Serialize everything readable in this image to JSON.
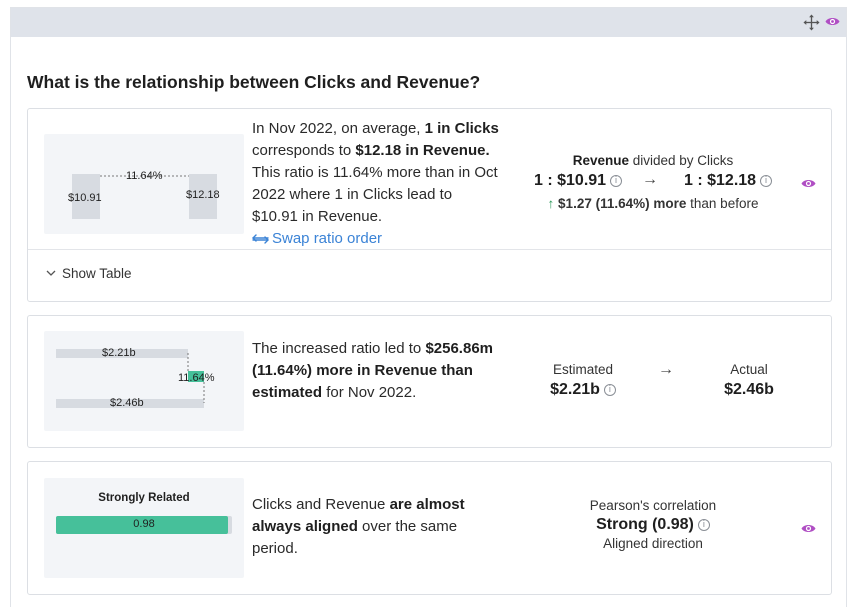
{
  "question": "What is the relationship between Clicks and Revenue?",
  "card1": {
    "mini": {
      "left_value": "$10.91",
      "right_value": "$12.18",
      "pct": "11.64%"
    },
    "desc": {
      "p1": "In Nov 2022, on average, ",
      "b1": "1 in Clicks",
      "p2": " corresponds to ",
      "b2": "$12.18 in Revenue.",
      "p3": " This ratio is 11.64% more than in Oct 2022 where 1 in Clicks lead to $10.91 in Revenue."
    },
    "swap_label": "Swap ratio order",
    "metric_label_bold": "Revenue",
    "metric_label_rest": " divided by Clicks",
    "ratio_before": "1 : $10.91",
    "ratio_after": "1 : $12.18",
    "change_value": "$1.27 (11.64%)",
    "change_word": "more",
    "change_suffix": " than before",
    "show_table": "Show Table"
  },
  "card2": {
    "mini": {
      "top_value": "$2.21b",
      "bottom_value": "$2.46b",
      "pct": "11.64%"
    },
    "desc": {
      "p1": "The increased ratio led to ",
      "b1": "$256.86m (11.64%) more in Revenue than estimated",
      "p2": " for Nov 2022."
    },
    "estimated_label": "Estimated",
    "estimated_value": "$2.21b",
    "actual_label": "Actual",
    "actual_value": "$2.46b"
  },
  "card3": {
    "mini": {
      "title": "Strongly Related",
      "value": "0.98",
      "fill": 0.98
    },
    "desc": {
      "p1": "Clicks and Revenue ",
      "b1": "are almost always aligned",
      "p2": " over the same period."
    },
    "metric_label": "Pearson's correlation",
    "metric_value": "Strong (0.98)",
    "metric_sub": "Aligned direction"
  },
  "icons": {
    "info": "i",
    "arrow_right": "→",
    "arrow_up": "↑"
  },
  "colors": {
    "accent_purple": "#b04fc4",
    "link_blue": "#3b83d6",
    "green": "#46c09a",
    "up_green": "#2e9a5c"
  }
}
